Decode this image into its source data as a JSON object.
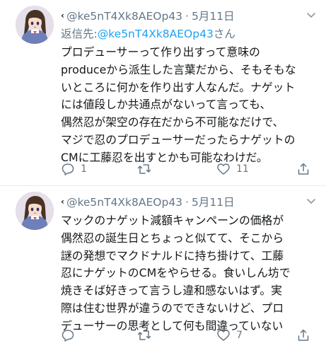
{
  "tweets": [
    {
      "handle": "@ke5nT4Xk8AEOp43",
      "date": "5月11日",
      "reply_prefix": "返信先:",
      "reply_mention": "@ke5nT4Xk8AEOp43",
      "reply_suffix": "さん",
      "lines": [
        "プロデューサーって作り出すって意味の",
        "produceから派生した言葉だから、そもそもな",
        "いところに何かを作り出す人なんだ。ナゲット",
        "には値段しか共通点がないって言っても、",
        "偶然忍が架空の存在だから不可能なだけで、",
        "マジで忍のプロデューサーだったらナゲットの",
        "CMに工藤忍を出すとかも可能なわけだ。"
      ],
      "reply_count": "1",
      "retweet_count": "",
      "like_count": "11"
    },
    {
      "handle": "@ke5nT4Xk8AEOp43",
      "date": "5月11日",
      "lines": [
        "マックのナゲット減額キャンペーンの価格が",
        "偶然忍の誕生日とちょっと似てて、そこから",
        "謎の発想でマクドナルドに持ち掛けて、工藤",
        "忍にナゲットのCMをやらせる。食いしん坊で",
        "焼きそば好きって言うし違和感ないはず。実",
        "際は住む世界が違うのでできないけど、プロ",
        "デューサーの思考として何も間違っていない"
      ],
      "reply_count": "",
      "retweet_count": "",
      "like_count": "7"
    }
  ],
  "colors": {
    "text": "#14171a",
    "secondary": "#657786",
    "link": "#1da1f2",
    "divider": "#e6ecf0"
  },
  "icons": [
    "avatar",
    "caret-down-icon",
    "reply-icon",
    "retweet-icon",
    "like-icon",
    "share-icon"
  ]
}
